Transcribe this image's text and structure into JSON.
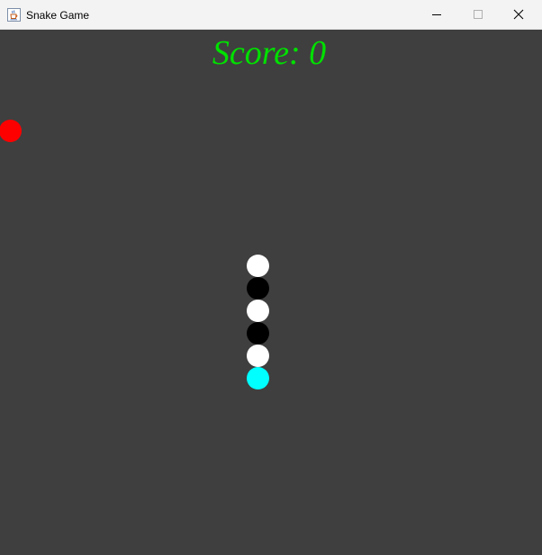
{
  "window": {
    "title": "Snake Game",
    "icon": "java-cup-icon",
    "controls": {
      "minimize_icon": "minimize-icon",
      "maximize_icon": "maximize-icon",
      "close_icon": "close-icon"
    }
  },
  "game": {
    "score_text": "Score: 0",
    "score": 0,
    "colors": {
      "background": "#3f3f3f",
      "score_text": "#00e000",
      "apple": "#ff0000",
      "snake_head": "#00ffff",
      "snake_body_light": "#ffffff",
      "snake_body_dark": "#000000"
    },
    "snake": {
      "length": 6,
      "segment_colors": [
        "#ffffff",
        "#000000",
        "#ffffff",
        "#000000",
        "#ffffff",
        "#00ffff"
      ]
    }
  }
}
